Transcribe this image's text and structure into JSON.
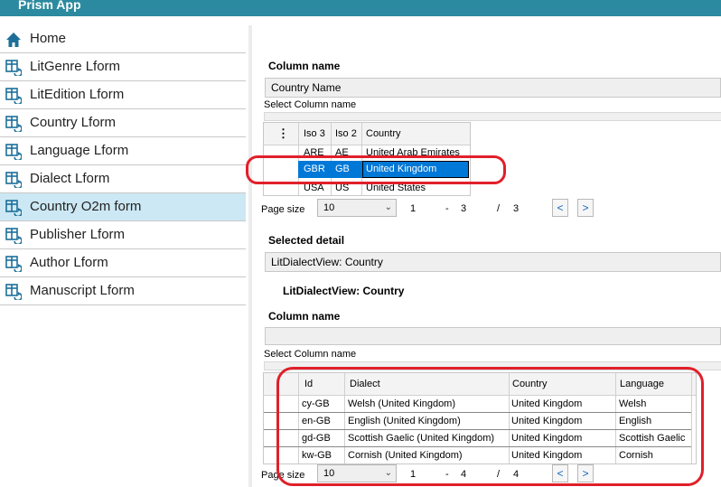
{
  "app": {
    "title": "Prism App"
  },
  "sidebar": {
    "items": [
      {
        "label": "Home",
        "icon": "home-icon"
      },
      {
        "label": "LitGenre Lform",
        "icon": "form-icon"
      },
      {
        "label": "LitEdition Lform",
        "icon": "form-icon"
      },
      {
        "label": "Country Lform",
        "icon": "form-icon"
      },
      {
        "label": "Language Lform",
        "icon": "form-icon"
      },
      {
        "label": "Dialect Lform",
        "icon": "form-icon"
      },
      {
        "label": "Country O2m form",
        "icon": "form-icon",
        "selected": true
      },
      {
        "label": "Publisher Lform",
        "icon": "form-icon"
      },
      {
        "label": "Author Lform",
        "icon": "form-icon"
      },
      {
        "label": "Manuscript Lform",
        "icon": "form-icon"
      }
    ]
  },
  "top": {
    "column_name_label": "Column name",
    "column_name_value": "Country Name",
    "select_column_label": "Select Column name",
    "grid": {
      "menu_glyph": "⋮",
      "headers": [
        "Iso 3",
        "Iso 2",
        "Country"
      ],
      "rows": [
        [
          "ARE",
          "AE",
          "United Arab Emirates"
        ],
        [
          "GBR",
          "GB",
          "United Kingdom"
        ],
        [
          "USA",
          "US",
          "United States"
        ]
      ],
      "selected_row": 1
    },
    "pager": {
      "label": "Page size",
      "size": "10",
      "from": "1",
      "dash": "-",
      "to": "3",
      "slash": "/",
      "total": "3",
      "prev": "<",
      "next": ">"
    }
  },
  "detail": {
    "selected_detail_label": "Selected detail",
    "selected_detail_value": "LitDialectView: Country",
    "view_title": "LitDialectView: Country",
    "column_name_label": "Column name",
    "column_name_value": "",
    "select_column_label": "Select Column name",
    "grid": {
      "headers": [
        "Id",
        "Dialect",
        "Country",
        "Language"
      ],
      "rows": [
        [
          "cy-GB",
          "Welsh (United Kingdom)",
          "United Kingdom",
          "Welsh"
        ],
        [
          "en-GB",
          "English (United Kingdom)",
          "United Kingdom",
          "English"
        ],
        [
          "gd-GB",
          "Scottish Gaelic (United Kingdom)",
          "United Kingdom",
          "Scottish Gaelic"
        ],
        [
          "kw-GB",
          "Cornish (United Kingdom)",
          "United Kingdom",
          "Cornish"
        ]
      ]
    },
    "pager": {
      "label": "Page size",
      "size": "10",
      "from": "1",
      "dash": "-",
      "to": "4",
      "slash": "/",
      "total": "4",
      "prev": "<",
      "next": ">"
    }
  },
  "colors": {
    "title_bar": "#2b8aa0",
    "selection": "#0078d7",
    "sidebar_selected": "#cce8f4",
    "annotation": "#e0202a",
    "icon": "#1d6f9a"
  }
}
